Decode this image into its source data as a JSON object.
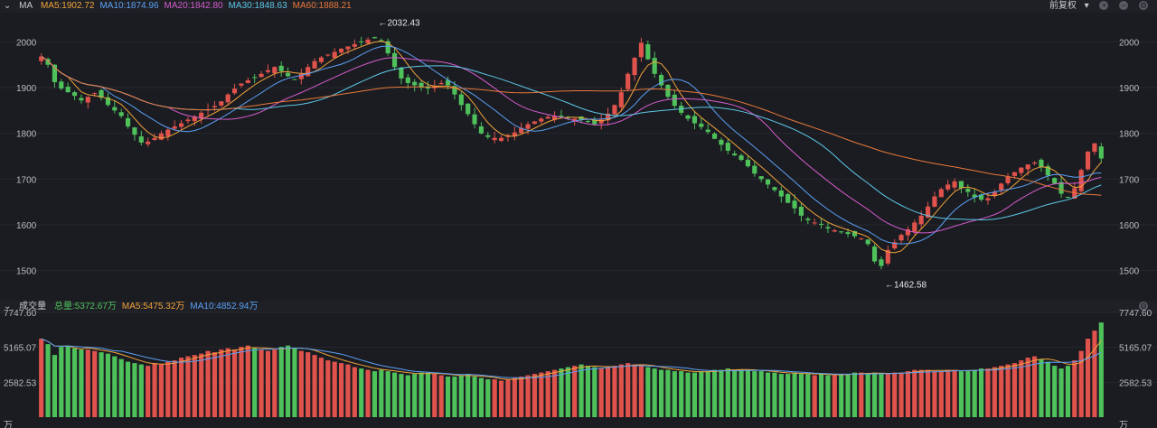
{
  "header": {
    "indicator": "MA",
    "ma_labels": [
      {
        "text": "MA5:1902.72",
        "color": "#f0a23b"
      },
      {
        "text": "MA10:1874.96",
        "color": "#5aa0f5"
      },
      {
        "text": "MA20:1842.80",
        "color": "#d65ccf"
      },
      {
        "text": "MA30:1848.63",
        "color": "#5cc7e8"
      },
      {
        "text": "MA60:1888.21",
        "color": "#e8793b"
      }
    ],
    "adjust_label": "前复权"
  },
  "volume_header": {
    "indicator": "成交量",
    "labels": [
      {
        "text": "总量:5372.67万",
        "color": "#4ec15b"
      },
      {
        "text": "MA5:5475.32万",
        "color": "#f0a23b"
      },
      {
        "text": "MA10:4852.94万",
        "color": "#5aa0f5"
      }
    ]
  },
  "chart_data": [
    {
      "type": "candlestick",
      "y_ticks": [
        "2000",
        "1900",
        "1800",
        "1700",
        "1600",
        "1500"
      ],
      "ylim": [
        1440,
        2060
      ],
      "annotations": {
        "high": "←2032.43",
        "low": "←1462.58"
      },
      "colors": {
        "up": "#e0524c",
        "down": "#4ec15b",
        "ma5": "#f0a23b",
        "ma10": "#5aa0f5",
        "ma20": "#d65ccf",
        "ma30": "#5cc7e8",
        "ma60": "#e8793b"
      },
      "closes": [
        1968,
        1950,
        1912,
        1898,
        1890,
        1882,
        1872,
        1880,
        1888,
        1878,
        1862,
        1850,
        1838,
        1815,
        1797,
        1780,
        1782,
        1790,
        1800,
        1808,
        1815,
        1822,
        1830,
        1837,
        1845,
        1852,
        1860,
        1870,
        1885,
        1898,
        1909,
        1916,
        1922,
        1930,
        1938,
        1945,
        1936,
        1925,
        1918,
        1930,
        1945,
        1958,
        1966,
        1972,
        1978,
        1985,
        1990,
        1995,
        2000,
        2005,
        2008,
        2000,
        1975,
        1945,
        1920,
        1910,
        1905,
        1900,
        1898,
        1903,
        1910,
        1905,
        1885,
        1862,
        1842,
        1820,
        1800,
        1792,
        1790,
        1790,
        1796,
        1802,
        1812,
        1820,
        1826,
        1832,
        1836,
        1838,
        1836,
        1834,
        1832,
        1830,
        1826,
        1820,
        1830,
        1843,
        1862,
        1890,
        1930,
        1965,
        1998,
        1962,
        1930,
        1905,
        1880,
        1860,
        1845,
        1832,
        1822,
        1814,
        1803,
        1788,
        1775,
        1762,
        1752,
        1742,
        1728,
        1712,
        1700,
        1688,
        1676,
        1662,
        1648,
        1636,
        1620,
        1610,
        1605,
        1600,
        1592,
        1588,
        1584,
        1580,
        1575,
        1570,
        1558,
        1520,
        1510,
        1545,
        1562,
        1578,
        1590,
        1605,
        1620,
        1640,
        1662,
        1678,
        1688,
        1695,
        1680,
        1672,
        1660,
        1655,
        1658,
        1672,
        1690,
        1705,
        1715,
        1725,
        1732,
        1736,
        1726,
        1708,
        1690,
        1668,
        1660,
        1680,
        1720,
        1760,
        1778,
        1745
      ],
      "volumes": [
        5800,
        5400,
        4600,
        5200,
        5300,
        5100,
        5000,
        5000,
        4900,
        4800,
        4700,
        4500,
        4300,
        4100,
        4000,
        3900,
        3800,
        4000,
        3900,
        4100,
        4200,
        4400,
        4500,
        4600,
        4700,
        4900,
        4800,
        5000,
        5100,
        5000,
        5200,
        5300,
        5100,
        5000,
        4900,
        5000,
        5200,
        5300,
        5100,
        4900,
        4800,
        4600,
        4400,
        4200,
        4100,
        4000,
        3900,
        3700,
        3600,
        3500,
        3400,
        3500,
        3400,
        3300,
        3200,
        3100,
        3200,
        3300,
        3300,
        3200,
        3100,
        3000,
        3000,
        3100,
        3200,
        3000,
        2900,
        2800,
        2800,
        2700,
        2800,
        2900,
        3000,
        3100,
        3200,
        3300,
        3400,
        3500,
        3600,
        3700,
        3800,
        3900,
        3800,
        3700,
        3600,
        3700,
        3800,
        3900,
        4000,
        3900,
        3800,
        3700,
        3600,
        3500,
        3500,
        3400,
        3400,
        3300,
        3300,
        3400,
        3400,
        3500,
        3500,
        3600,
        3500,
        3500,
        3500,
        3400,
        3400,
        3300,
        3300,
        3200,
        3200,
        3300,
        3200,
        3200,
        3100,
        3200,
        3100,
        3100,
        3200,
        3200,
        3300,
        3300,
        3200,
        3300,
        3200,
        3200,
        3300,
        3300,
        3400,
        3500,
        3500,
        3500,
        3400,
        3400,
        3500,
        3500,
        3400,
        3400,
        3500,
        3600,
        3600,
        3700,
        3800,
        3900,
        4000,
        4200,
        4400,
        4500,
        4300,
        4100,
        3800,
        3600,
        3800,
        4200,
        4900,
        5800,
        6400,
        7000
      ],
      "vol_colors_seed": 7
    },
    {
      "type": "volume",
      "y_ticks": [
        "7747.60",
        "5165.07",
        "2582.53",
        "万"
      ],
      "ylim": [
        0,
        7747.6
      ]
    }
  ]
}
